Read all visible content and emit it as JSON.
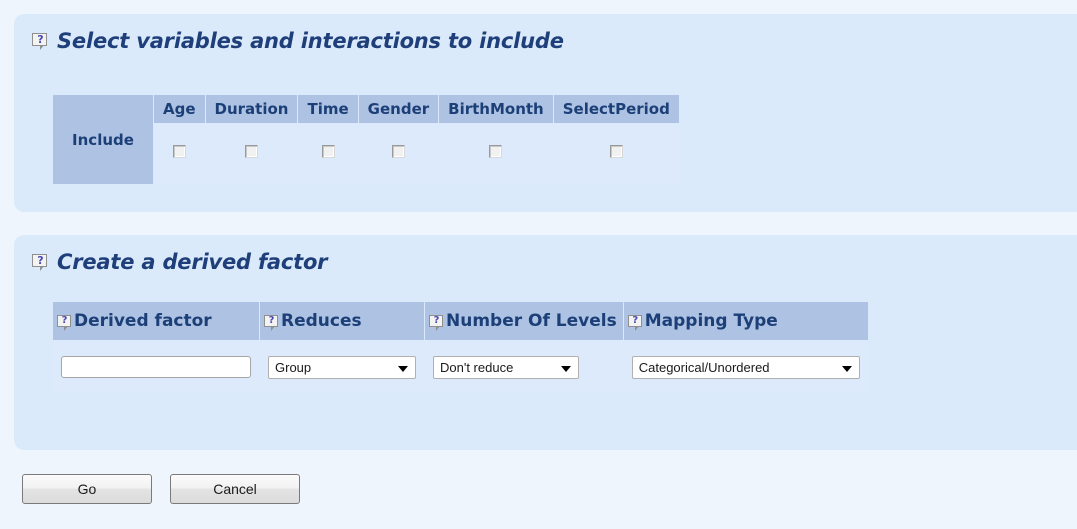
{
  "sections": {
    "variables": {
      "heading": "Select variables and interactions to include",
      "help_icon": "help-balloon-icon",
      "row_label": "Include",
      "columns": [
        "Age",
        "Duration",
        "Time",
        "Gender",
        "BirthMonth",
        "SelectPeriod"
      ],
      "checkboxes": [
        {
          "variable": "Age",
          "checked": false,
          "enabled": false
        },
        {
          "variable": "Duration",
          "checked": false,
          "enabled": false
        },
        {
          "variable": "Time",
          "checked": false,
          "enabled": false
        },
        {
          "variable": "Gender",
          "checked": false,
          "enabled": false
        },
        {
          "variable": "BirthMonth",
          "checked": false,
          "enabled": false
        },
        {
          "variable": "SelectPeriod",
          "checked": false,
          "enabled": false
        }
      ]
    },
    "derived": {
      "heading": "Create a derived factor",
      "help_icon": "help-balloon-icon",
      "columns": {
        "derived_factor": "Derived factor",
        "reduces": "Reduces",
        "levels": "Number Of Levels",
        "mapping": "Mapping Type"
      },
      "fields": {
        "derived_factor_value": "",
        "derived_factor_placeholder": "",
        "reduces_value": "Group",
        "levels_value": "Don't reduce",
        "mapping_value": "Categorical/Unordered"
      }
    }
  },
  "buttons": {
    "go": "Go",
    "cancel": "Cancel"
  },
  "colors": {
    "page_background": "#eff5fc",
    "panel_background": "#daeafb",
    "table_header": "#aec3e4",
    "table_cell": "#ddeafb",
    "heading_text": "#1f3f7a",
    "help_question": "#4a4ab5"
  }
}
